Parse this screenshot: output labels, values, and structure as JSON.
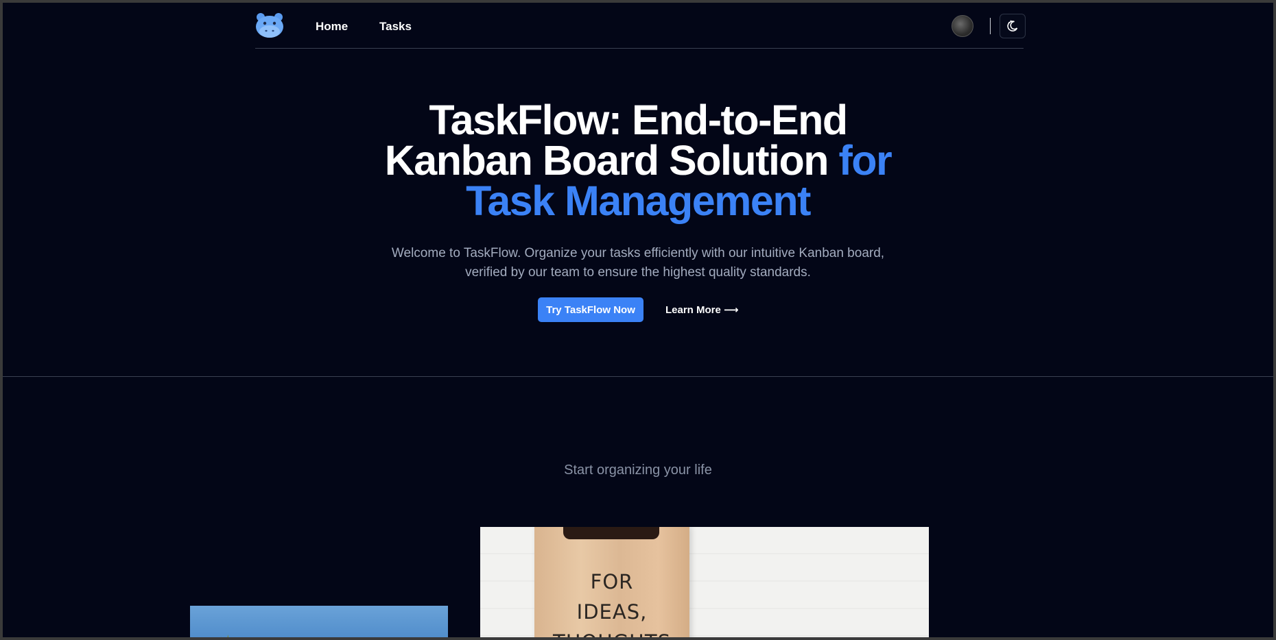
{
  "nav": {
    "home_label": "Home",
    "tasks_label": "Tasks"
  },
  "hero": {
    "title_line1": "TaskFlow: End-to-End",
    "title_line2_main": "Kanban Board Solution ",
    "title_line2_accent": "for",
    "title_line3_accent": "Task Management",
    "subtitle_line1": "Welcome to TaskFlow. Organize your tasks efficiently with our intuitive Kanban board,",
    "subtitle_line2": "verified by our team to ensure the highest quality standards.",
    "primary_button": "Try TaskFlow Now",
    "secondary_link": "Learn More ⟶"
  },
  "section": {
    "title": "Start organizing your life"
  },
  "images": {
    "clipboard_line1": "FOR",
    "clipboard_line2": "IDEAS,",
    "clipboard_line3": "THOUGHTS"
  },
  "colors": {
    "background": "#030617",
    "accent": "#3b82f6",
    "text": "#ffffff",
    "muted": "#a3acbf"
  },
  "icons": {
    "logo": "hippo-logo-icon",
    "avatar": "user-avatar",
    "theme_toggle": "moon-sun-icon"
  }
}
